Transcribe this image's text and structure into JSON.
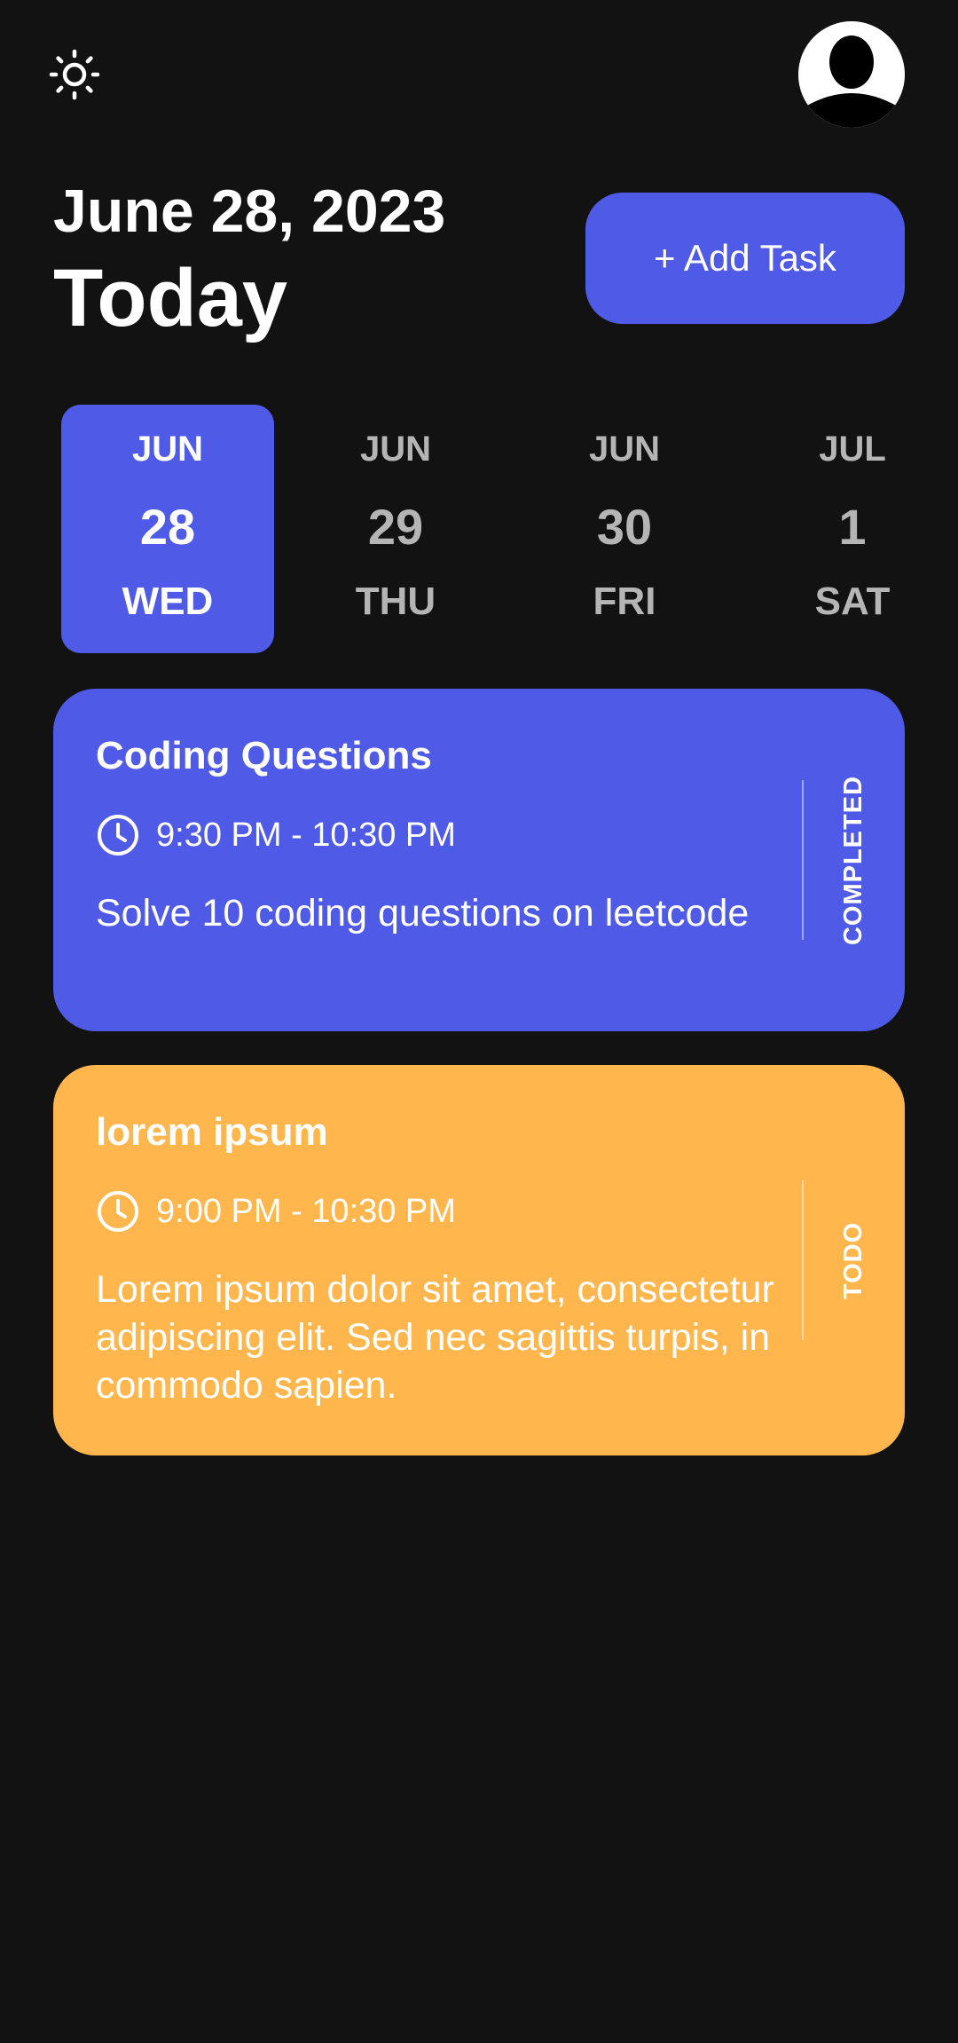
{
  "header": {
    "theme_icon": "sun-icon",
    "avatar_icon": "user-silhouette-icon",
    "date": "June 28, 2023",
    "today": "Today",
    "add_task_label": "+ Add Task"
  },
  "colors": {
    "background": "#121212",
    "accent": "#4f5be6",
    "todo": "#ffb74d",
    "inactive_text": "#b5b5b5"
  },
  "days": [
    {
      "month": "JUN",
      "day": "28",
      "weekday": "WED",
      "selected": true
    },
    {
      "month": "JUN",
      "day": "29",
      "weekday": "THU",
      "selected": false
    },
    {
      "month": "JUN",
      "day": "30",
      "weekday": "FRI",
      "selected": false
    },
    {
      "month": "JUL",
      "day": "1",
      "weekday": "SAT",
      "selected": false
    }
  ],
  "tasks": [
    {
      "title": "Coding Questions",
      "time": "9:30 PM - 10:30 PM",
      "description": "Solve 10 coding questions on leetcode",
      "status": "COMPLETED",
      "color": "#4f5be6",
      "icon": "clock-icon"
    },
    {
      "title": "lorem ipsum",
      "time": "9:00 PM - 10:30 PM",
      "description": "Lorem ipsum dolor sit amet, consectetur adipiscing elit. Sed nec sagittis turpis, in commodo sapien.",
      "status": "TODO",
      "color": "#ffb74d",
      "icon": "clock-icon"
    }
  ]
}
